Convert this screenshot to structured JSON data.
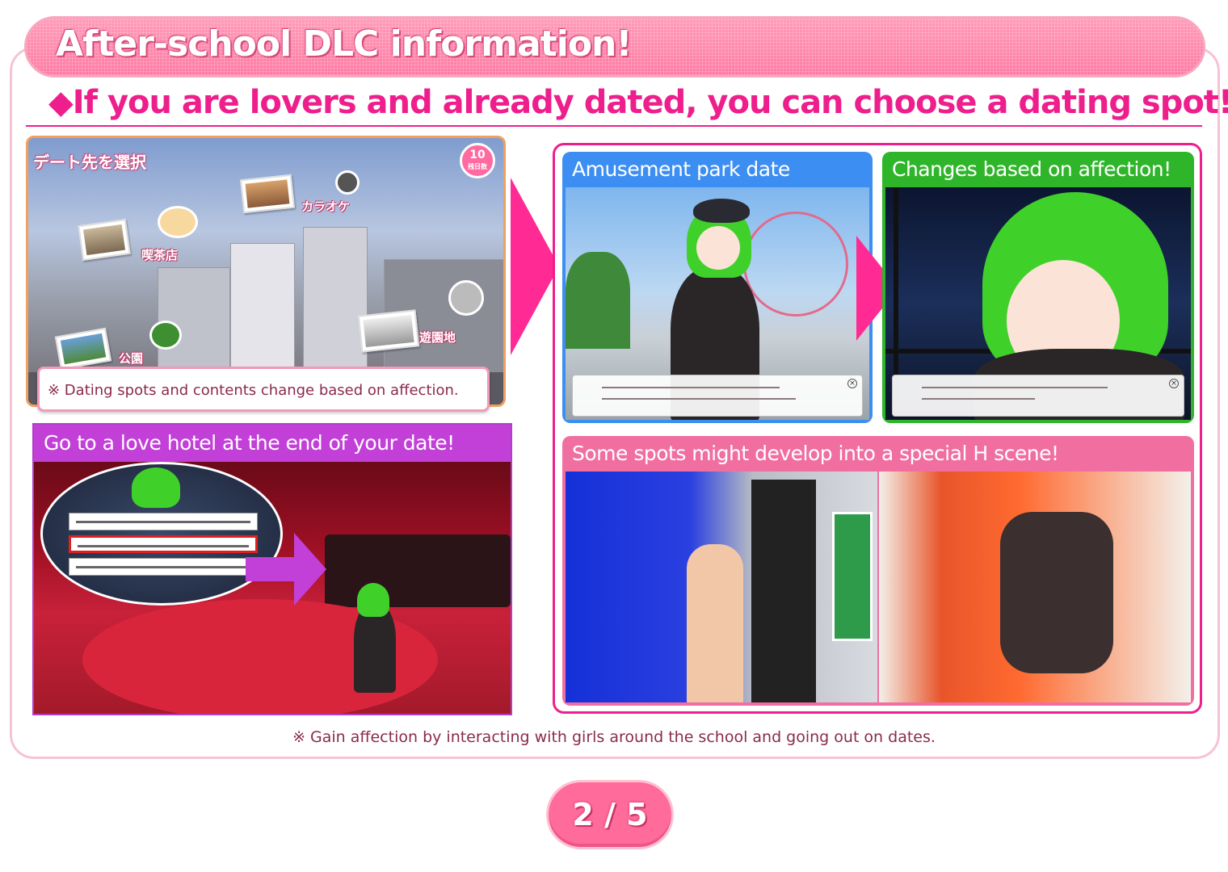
{
  "header": {
    "title": "After-school DLC information!"
  },
  "subtitle": "◆If you are lovers and already dated, you can choose a dating spot!",
  "select_screen": {
    "heading": "デート先を選択",
    "days_left": "10",
    "days_caption": "残日数",
    "spots": {
      "cafe": "喫茶店",
      "karaoke": "カラオケ",
      "park": "公園",
      "amusement": "遊園地"
    },
    "note": "※ Dating spots and contents change based on affection."
  },
  "amusement": {
    "title": "Amusement park date"
  },
  "affection": {
    "title": "Changes based on affection!"
  },
  "hotel": {
    "title": "Go to a love hotel at the end of your date!"
  },
  "hscene": {
    "title": "Some spots might develop into a special H scene!"
  },
  "footer_note": "※ Gain affection by interacting with girls around the school and going out on dates.",
  "pager": {
    "label": "2 / 5"
  },
  "colors": {
    "accent_pink": "#ee1f8c",
    "header_pink": "#ff85ac",
    "amusement_blue": "#3c8ef2",
    "affection_green": "#2fb52a",
    "hotel_purple": "#c240d8",
    "hscene_pink": "#f06fa0"
  }
}
